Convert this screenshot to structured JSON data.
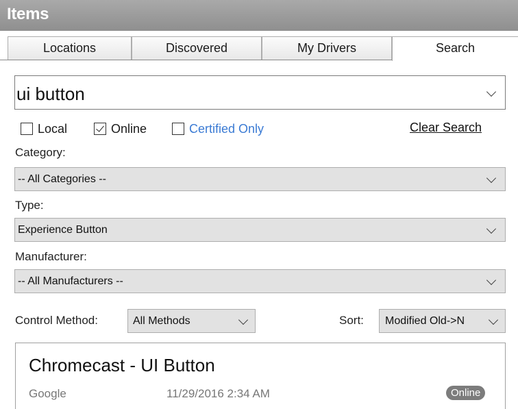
{
  "panel_title": "Items",
  "tabs": [
    {
      "label": "Locations",
      "active": false
    },
    {
      "label": "Discovered",
      "active": false
    },
    {
      "label": "My Drivers",
      "active": false
    },
    {
      "label": "Search",
      "active": true
    }
  ],
  "search": {
    "value": "ui button"
  },
  "filters": {
    "local": {
      "label": "Local",
      "checked": false
    },
    "online": {
      "label": "Online",
      "checked": true
    },
    "certified": {
      "label": "Certified Only",
      "checked": false
    },
    "clear_label": "Clear Search"
  },
  "category": {
    "label": "Category:",
    "value": "-- All Categories --"
  },
  "type": {
    "label": "Type:",
    "value": "Experience Button"
  },
  "manufacturer": {
    "label": "Manufacturer:",
    "value": "-- All Manufacturers --"
  },
  "control_method": {
    "label": "Control Method:",
    "value": "All Methods"
  },
  "sort": {
    "label": "Sort:",
    "value": "Modified Old->N"
  },
  "results": [
    {
      "title": "Chromecast - UI Button",
      "manufacturer": "Google",
      "date": "11/29/2016 2:34 AM",
      "status": "Online"
    }
  ],
  "colors": {
    "title_bar": "#9b9b9b",
    "certified_link": "#3b7bd4",
    "badge": "#7c7c7c"
  }
}
